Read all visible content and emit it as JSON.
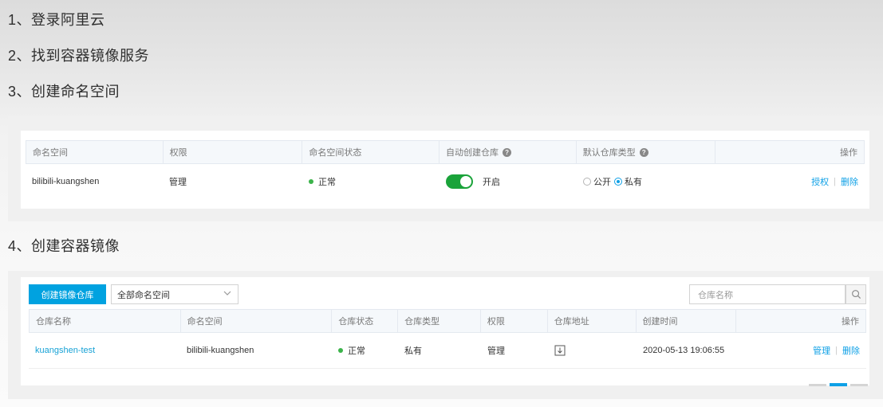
{
  "steps": [
    "1、登录阿里云",
    "2、找到容器镜像服务",
    "3、创建命名空间",
    "4、创建容器镜像"
  ],
  "namespace_table": {
    "headers": [
      "命名空间",
      "权限",
      "命名空间状态",
      "自动创建仓库",
      "默认仓库类型",
      "操作"
    ],
    "row": {
      "namespace": "bilibili-kuangshen",
      "permission": "管理",
      "status": "正常",
      "auto_create": "开启",
      "auto_create_enabled": true,
      "type_public": "公开",
      "type_private": "私有",
      "selected_type": "私有",
      "action_grant": "授权",
      "action_delete": "删除"
    }
  },
  "repo_toolbar": {
    "create_button": "创建镜像仓库",
    "namespace_select": "全部命名空间",
    "search_placeholder": "仓库名称"
  },
  "repo_table": {
    "headers": [
      "仓库名称",
      "命名空间",
      "仓库状态",
      "仓库类型",
      "权限",
      "仓库地址",
      "创建时间",
      "操作"
    ],
    "row": {
      "name": "kuangshen-test",
      "namespace": "bilibili-kuangshen",
      "status": "正常",
      "type": "私有",
      "permission": "管理",
      "created": "2020-05-13 19:06:55",
      "action_manage": "管理",
      "action_delete": "删除"
    }
  },
  "colors": {
    "accent": "#00a2e0",
    "link": "#0ea0e6",
    "status_ok": "#3bb34a",
    "toggle_on": "#1aa33a"
  },
  "icons": {
    "help": "question-circle-icon",
    "chevron": "chevron-down-icon",
    "search": "search-icon",
    "address": "download-icon"
  }
}
